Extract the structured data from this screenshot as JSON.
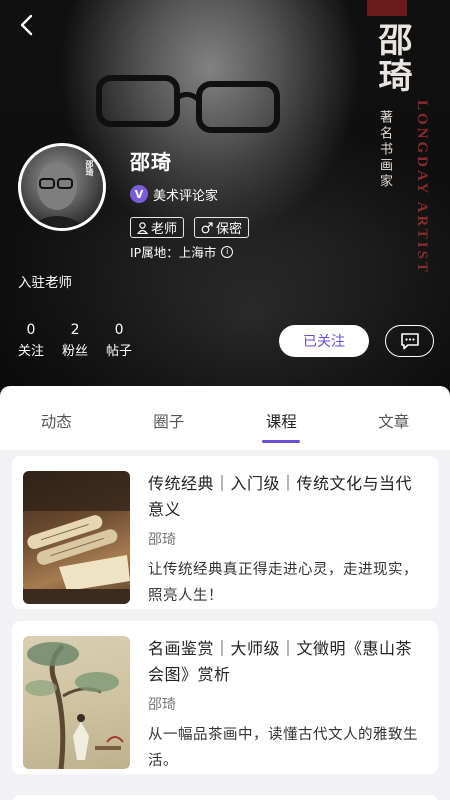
{
  "profile": {
    "name": "邵琦",
    "certification": "美术评论家",
    "cert_badge": "V",
    "tags": [
      {
        "icon": "person-icon",
        "label": "老师"
      },
      {
        "icon": "male-icon",
        "label": "保密"
      }
    ],
    "ip_location": "IP属地：上海市",
    "settled_label": "入驻老师",
    "stats": [
      {
        "value": "0",
        "label": "关注"
      },
      {
        "value": "2",
        "label": "粉丝"
      },
      {
        "value": "0",
        "label": "帖子"
      }
    ],
    "follow_button": "已关注",
    "avatar_text": "邵琦"
  },
  "banner": {
    "name": "邵琦",
    "subtitle": "著名书画家",
    "english": "LONGDAY ARTIST"
  },
  "tabs": [
    {
      "label": "动态",
      "active": false
    },
    {
      "label": "圈子",
      "active": false
    },
    {
      "label": "课程",
      "active": true
    },
    {
      "label": "文章",
      "active": false
    }
  ],
  "courses": [
    {
      "title": "传统经典｜入门级｜传统文化与当代意义",
      "author": "邵琦",
      "description": "让传统经典真正得走进心灵，走进现实，照亮人生！"
    },
    {
      "title": "名画鉴赏｜大师级｜文徵明《惠山茶会图》赏析",
      "author": "邵琦",
      "description": "从一幅品茶画中，读懂古代文人的雅致生活。"
    }
  ],
  "colors": {
    "accent": "#6a4fd0",
    "badge": "#7b5cd6",
    "banner_red": "#8a2b2b"
  }
}
